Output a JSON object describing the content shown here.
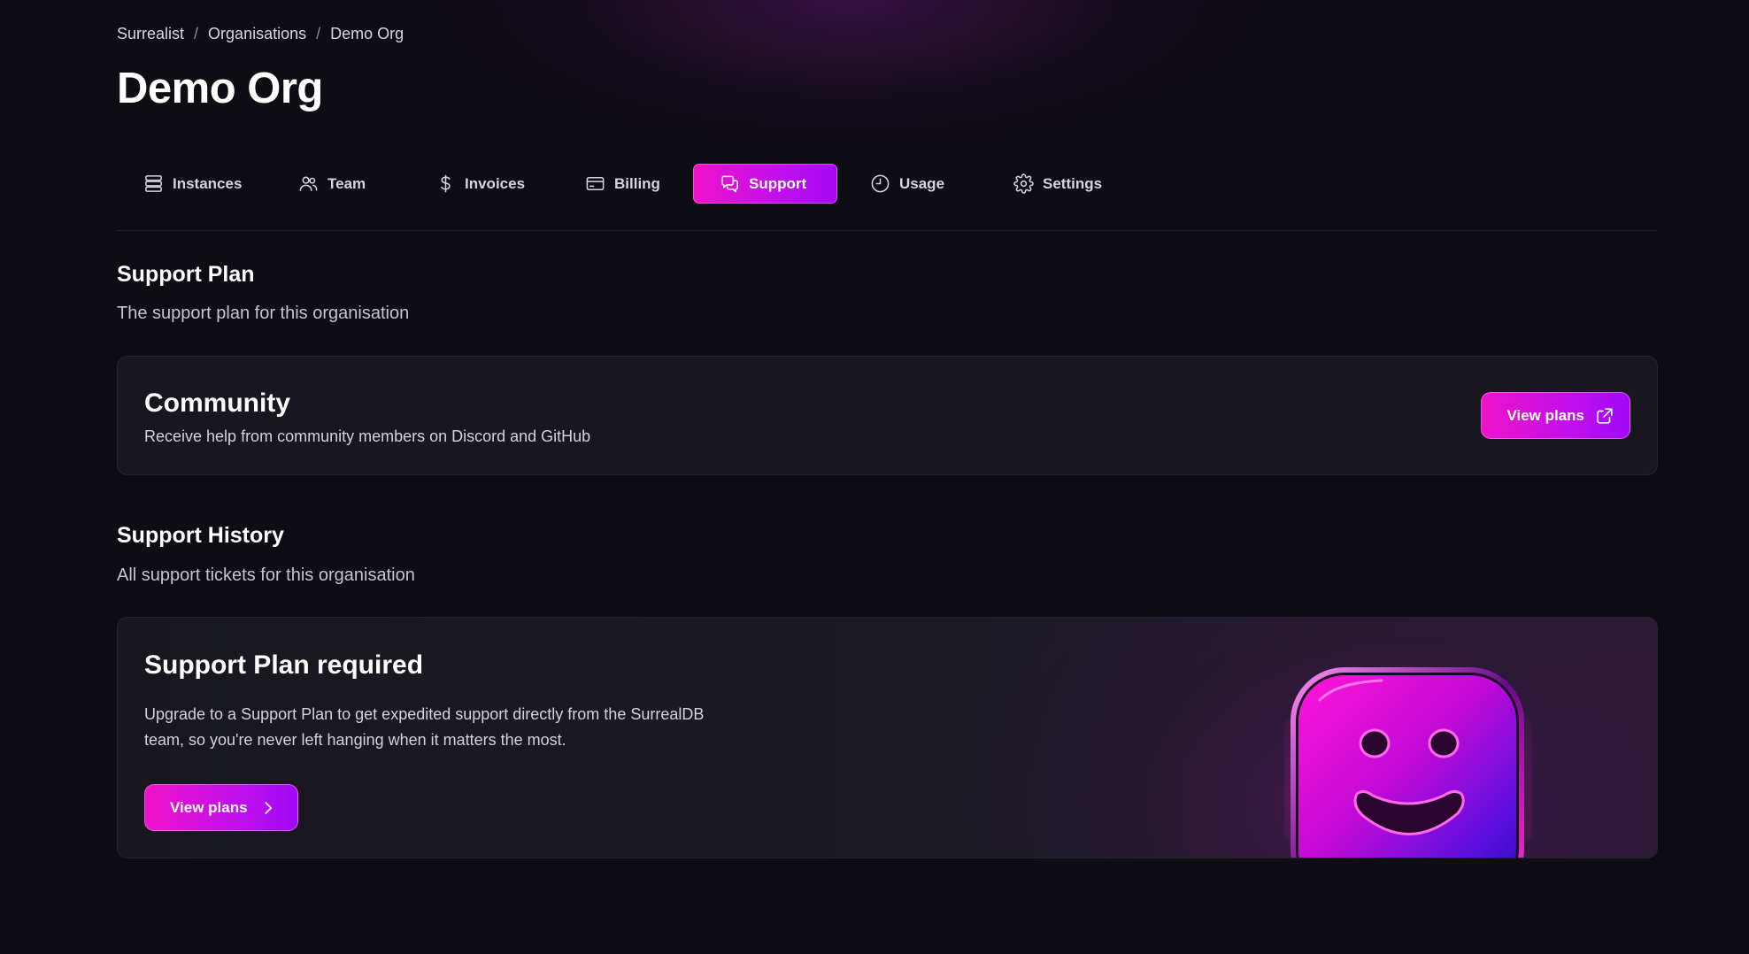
{
  "breadcrumb": {
    "items": [
      "Surrealist",
      "Organisations",
      "Demo Org"
    ],
    "separator": "/"
  },
  "page": {
    "title": "Demo Org"
  },
  "tabs": [
    {
      "label": "Instances",
      "icon": "server-stack-icon",
      "active": false
    },
    {
      "label": "Team",
      "icon": "users-icon",
      "active": false
    },
    {
      "label": "Invoices",
      "icon": "dollar-icon",
      "active": false
    },
    {
      "label": "Billing",
      "icon": "credit-card-icon",
      "active": false
    },
    {
      "label": "Support",
      "icon": "chat-bubbles-icon",
      "active": true
    },
    {
      "label": "Usage",
      "icon": "clock-icon",
      "active": false
    },
    {
      "label": "Settings",
      "icon": "gear-icon",
      "active": false
    }
  ],
  "support_plan": {
    "title": "Support Plan",
    "description": "The support plan for this organisation",
    "plan_name": "Community",
    "plan_description": "Receive help from community members on Discord and GitHub",
    "button_label": "View plans",
    "button_icon": "external-link-icon"
  },
  "support_history": {
    "title": "Support History",
    "description": "All support tickets for this organisation",
    "empty_title": "Support Plan required",
    "empty_description": "Upgrade to a Support Plan to get expedited support directly from the SurrealDB team, so you're never left hanging when it matters the most.",
    "button_label": "View plans",
    "button_icon": "chevron-right-icon",
    "illustration": "smiley-mascot"
  },
  "colors": {
    "background": "#0e0d13",
    "card": "#18171f",
    "accent_start": "#f012c9",
    "accent_end": "#a508f4",
    "text_muted": "#c6c4cc"
  }
}
